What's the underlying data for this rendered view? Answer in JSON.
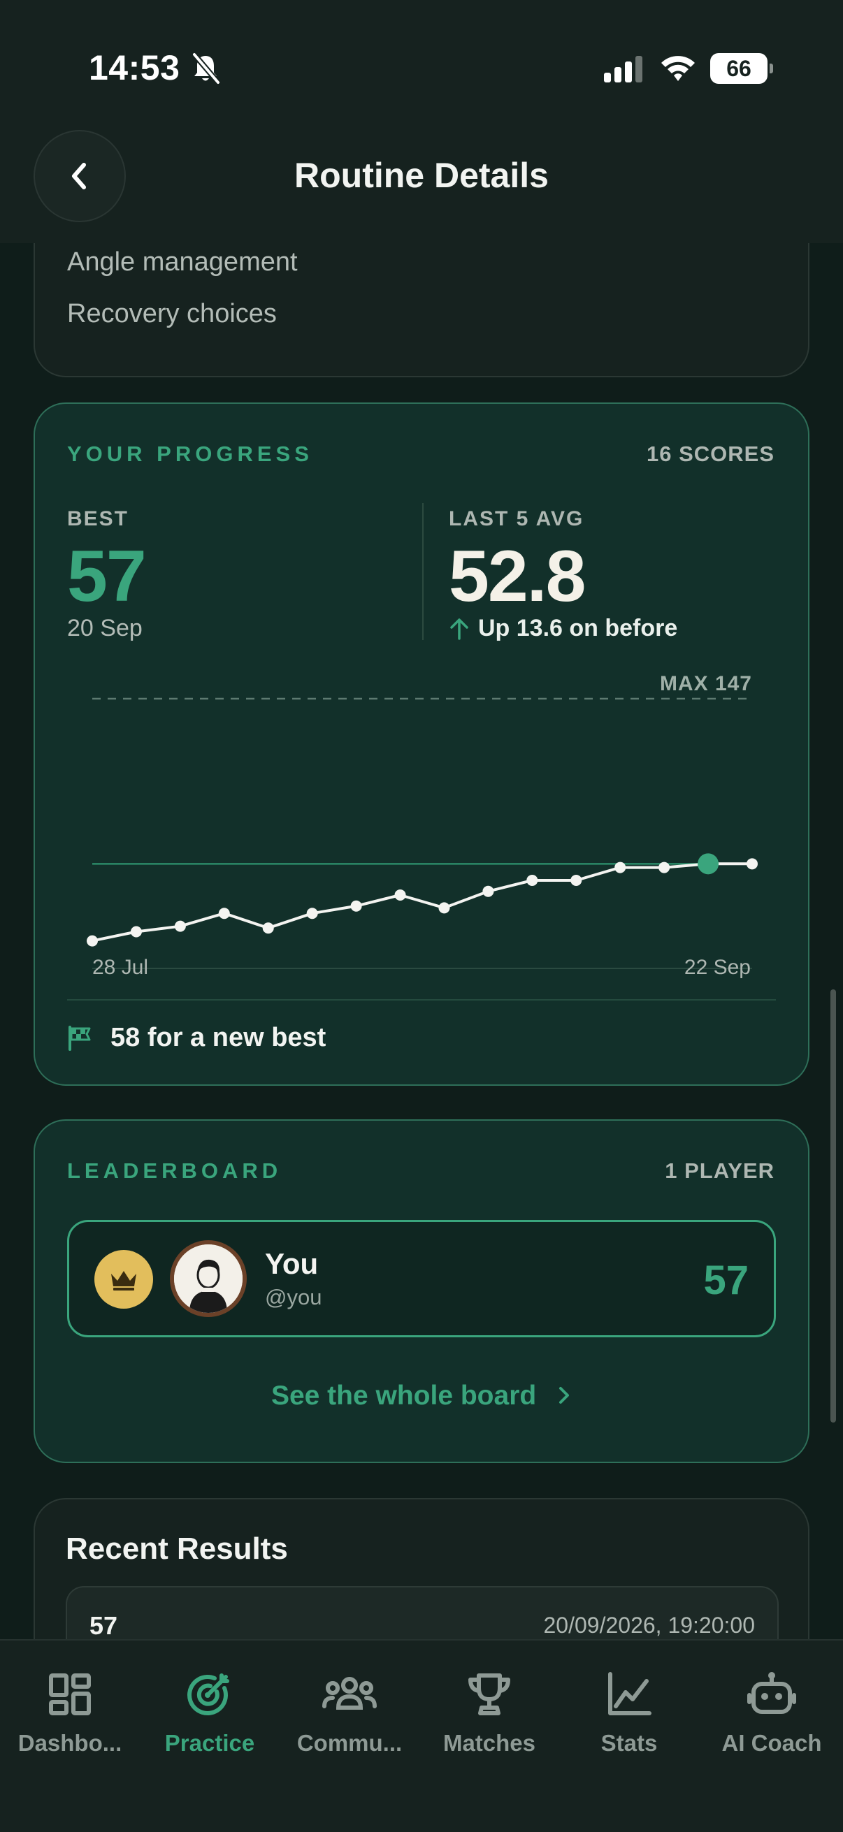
{
  "status_bar": {
    "time": "14:53",
    "battery": "66"
  },
  "header": {
    "title": "Routine Details"
  },
  "skills": [
    "Angle management",
    "Recovery choices"
  ],
  "progress": {
    "section_label": "YOUR PROGRESS",
    "count_label": "16 SCORES",
    "best_label": "BEST",
    "best_value": "57",
    "best_date": "20 Sep",
    "avg_label": "LAST 5 AVG",
    "avg_value": "52.8",
    "avg_change": "Up 13.6 on before",
    "goal_text": "58 for a new best",
    "colors": {
      "accent": "#3aa57d",
      "highlight_point": "#3aa57d"
    }
  },
  "chart_data": {
    "type": "line",
    "x_start_label": "28 Jul",
    "x_end_label": "22 Sep",
    "max_label": "MAX 147",
    "ymax": 147,
    "best_line": 57,
    "highlight_index": 14,
    "series": [
      {
        "values": [
          15,
          20,
          23,
          30,
          22,
          30,
          34,
          40,
          33,
          42,
          48,
          48,
          55,
          55,
          57,
          57
        ]
      }
    ]
  },
  "leaderboard": {
    "section_label": "LEADERBOARD",
    "count_label": "1 PLAYER",
    "entries": [
      {
        "name": "You",
        "handle": "@you",
        "score": "57"
      }
    ],
    "see_all": "See the whole board"
  },
  "recent": {
    "title": "Recent Results",
    "rows": [
      {
        "score": "57",
        "date": "20/09/2026, 19:20:00"
      }
    ]
  },
  "tabs": [
    {
      "label": "Dashbo...",
      "icon": "dashboard-icon"
    },
    {
      "label": "Practice",
      "icon": "target-icon",
      "active": true
    },
    {
      "label": "Commu...",
      "icon": "community-icon"
    },
    {
      "label": "Matches",
      "icon": "trophy-icon"
    },
    {
      "label": "Stats",
      "icon": "stats-icon"
    },
    {
      "label": "AI Coach",
      "icon": "robot-icon"
    }
  ]
}
